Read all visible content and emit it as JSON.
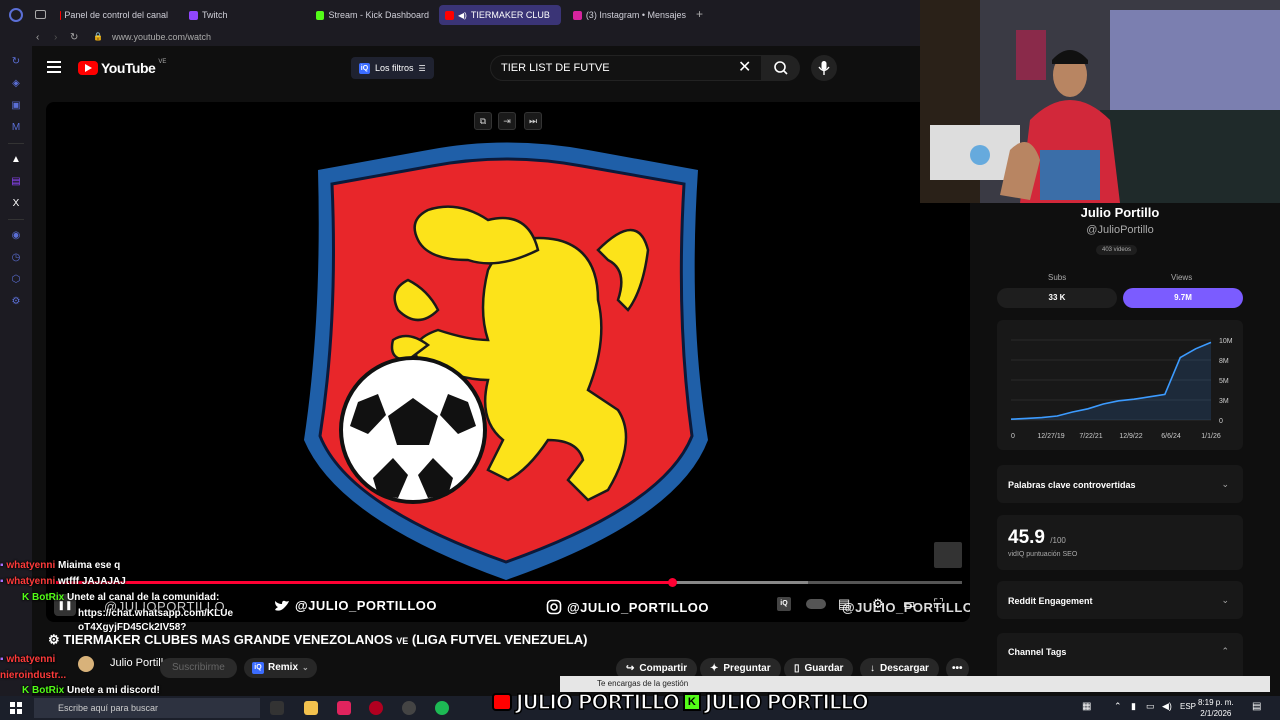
{
  "browser": {
    "tabs": [
      {
        "label": "Panel de control del canal",
        "color": "#ff0000"
      },
      {
        "label": "Twitch",
        "color": "#9146ff"
      },
      {
        "label": "Stream - Kick Dashboard",
        "color": "#53fc18"
      },
      {
        "label": "TIERMAKER CLUB",
        "color": "#ff0000"
      },
      {
        "label": "(3) Instagram • Mensajes",
        "color": "#d6249f"
      }
    ],
    "url": "www.youtube.com/watch"
  },
  "youtube": {
    "logo_text": "YouTube",
    "country": "VE",
    "filters_label": "Los filtros",
    "search_value": "TIER LIST DE FUTVE",
    "video": {
      "social_twitter": "@JULIO_PORTILLOO",
      "social_instagram": "@JULIO_PORTILLOO",
      "social_watermark_left": "@JULIOPORTILLO",
      "social_watermark_right": "@JULIO_PORTILLO",
      "progress": 0.68,
      "title": "TIERMAKER CLUBES MAS GRANDE VENEZOLANOS",
      "title_flag": "VE",
      "title_suffix": "(LIGA FUTVEL VENEZUELA)"
    },
    "channel_name": "Julio Portillo",
    "subscribe_label": "Suscribirme",
    "remix_label": "Remix",
    "actions": {
      "share": "Compartir",
      "ask": "Preguntar",
      "save": "Guardar",
      "download": "Descargar"
    }
  },
  "chat": [
    {
      "user": "whatyenni",
      "msg": "Miaima ese q",
      "color": "red"
    },
    {
      "user": "whatyenni",
      "msg": "wtfff JAJAJAJ",
      "color": "red"
    },
    {
      "user": "BotRix",
      "msg": "Unete al canal de la comunidad:",
      "color": "green"
    },
    {
      "user": "",
      "msg": "https://chat.whatsapp.com/KLUe",
      "color": "none"
    },
    {
      "user": "",
      "msg": "oT4XgyjFD45Ck2IV58?",
      "color": "none"
    },
    {
      "user": "whatyenni",
      "msg": "",
      "color": "red"
    },
    {
      "user": "nieroindustr...",
      "msg": "",
      "color": "red"
    },
    {
      "user": "BotRix",
      "msg": "Unete a mi discord!",
      "color": "green"
    }
  ],
  "vidiq": {
    "channel_name": "Julio Portillo",
    "handle": "@JulioPortillo",
    "videos": "403 videos",
    "subs_label": "Subs",
    "subs_value": "33 K",
    "views_label": "Views",
    "views_value": "9.7M",
    "chart_y_ticks": [
      "10M",
      "8M",
      "5M",
      "3M",
      "0"
    ],
    "chart_x_ticks": [
      "0",
      "12/27/19",
      "7/22/21",
      "12/9/22",
      "6/6/24",
      "1/1/26"
    ],
    "chart_values": [
      0.1,
      0.2,
      0.3,
      0.5,
      1.0,
      1.4,
      2.0,
      2.4,
      2.6,
      2.9,
      3.2,
      7.8,
      8.9,
      9.7
    ],
    "controversial_label": "Palabras clave controvertidas",
    "seo_score": "45.9",
    "seo_max": "/100",
    "seo_label": "vidIQ puntuación SEO",
    "reddit_label": "Reddit Engagement",
    "tags_label": "Channel Tags",
    "accent": "#7b5cff"
  },
  "toast": "Te encargas de la gestión",
  "taskbar": {
    "search_placeholder": "Escribe aquí para buscar",
    "lang": "ESP",
    "time": "8:19 p. m.",
    "date": "2/1/2026"
  },
  "banner": {
    "left": "JULIO PORTILLO",
    "right": "JULIO PORTILLO"
  }
}
